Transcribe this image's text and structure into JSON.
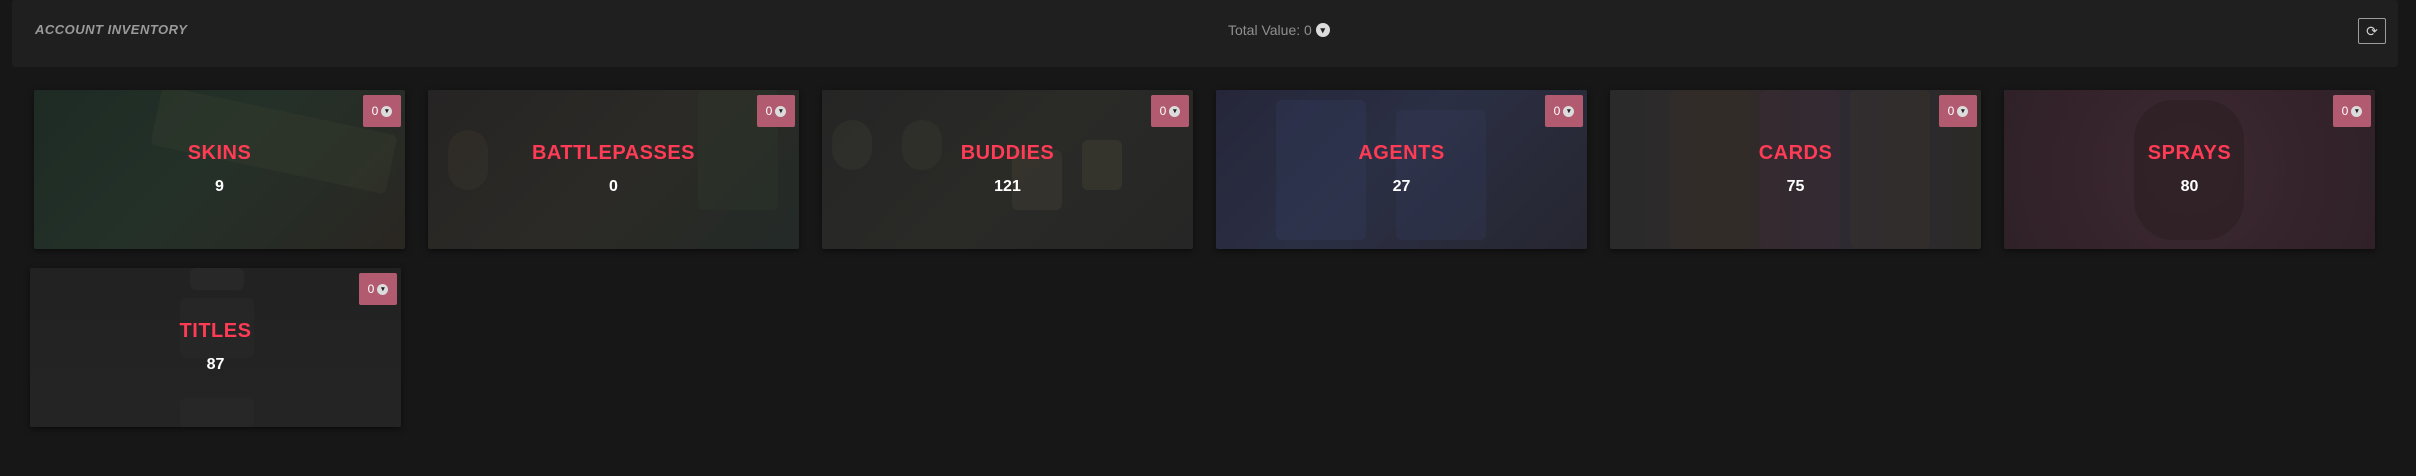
{
  "header": {
    "title": "ACCOUNT INVENTORY",
    "total_value_label": "Total Value: 0",
    "refresh_icon": "refresh-icon"
  },
  "colors": {
    "background": "#171717",
    "accent": "#ff3b55",
    "badge": "#b25a70",
    "sprays_tint": "#3a2730"
  },
  "categories": [
    {
      "title": "SKINS",
      "count": "9",
      "value": "0"
    },
    {
      "title": "BATTLEPASSES",
      "count": "0",
      "value": "0"
    },
    {
      "title": "BUDDIES",
      "count": "121",
      "value": "0"
    },
    {
      "title": "AGENTS",
      "count": "27",
      "value": "0"
    },
    {
      "title": "CARDS",
      "count": "75",
      "value": "0"
    },
    {
      "title": "SPRAYS",
      "count": "80",
      "value": "0"
    },
    {
      "title": "TITLES",
      "count": "87",
      "value": "0"
    }
  ]
}
